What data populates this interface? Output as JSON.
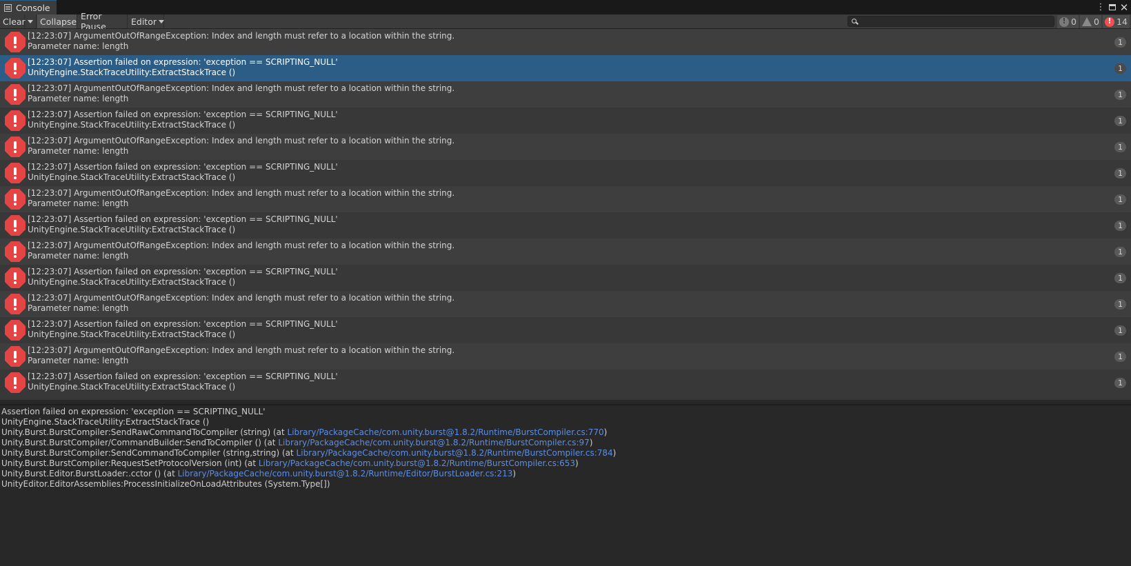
{
  "window": {
    "tab_title": "Console"
  },
  "toolbar": {
    "clear_label": "Clear",
    "collapse_label": "Collapse",
    "error_pause_label": "Error Pause",
    "editor_label": "Editor",
    "search_placeholder": "",
    "info_count": "0",
    "warning_count": "0",
    "error_count": "14"
  },
  "log_entries": [
    {
      "line1": "[12:23:07] ArgumentOutOfRangeException: Index and length must refer to a location within the string.",
      "line2": "Parameter name: length",
      "count": "1",
      "selected": false
    },
    {
      "line1": "[12:23:07] Assertion failed on expression: 'exception == SCRIPTING_NULL'",
      "line2": "UnityEngine.StackTraceUtility:ExtractStackTrace ()",
      "count": "1",
      "selected": true
    },
    {
      "line1": "[12:23:07] ArgumentOutOfRangeException: Index and length must refer to a location within the string.",
      "line2": "Parameter name: length",
      "count": "1",
      "selected": false
    },
    {
      "line1": "[12:23:07] Assertion failed on expression: 'exception == SCRIPTING_NULL'",
      "line2": "UnityEngine.StackTraceUtility:ExtractStackTrace ()",
      "count": "1",
      "selected": false
    },
    {
      "line1": "[12:23:07] ArgumentOutOfRangeException: Index and length must refer to a location within the string.",
      "line2": "Parameter name: length",
      "count": "1",
      "selected": false
    },
    {
      "line1": "[12:23:07] Assertion failed on expression: 'exception == SCRIPTING_NULL'",
      "line2": "UnityEngine.StackTraceUtility:ExtractStackTrace ()",
      "count": "1",
      "selected": false
    },
    {
      "line1": "[12:23:07] ArgumentOutOfRangeException: Index and length must refer to a location within the string.",
      "line2": "Parameter name: length",
      "count": "1",
      "selected": false
    },
    {
      "line1": "[12:23:07] Assertion failed on expression: 'exception == SCRIPTING_NULL'",
      "line2": "UnityEngine.StackTraceUtility:ExtractStackTrace ()",
      "count": "1",
      "selected": false
    },
    {
      "line1": "[12:23:07] ArgumentOutOfRangeException: Index and length must refer to a location within the string.",
      "line2": "Parameter name: length",
      "count": "1",
      "selected": false
    },
    {
      "line1": "[12:23:07] Assertion failed on expression: 'exception == SCRIPTING_NULL'",
      "line2": "UnityEngine.StackTraceUtility:ExtractStackTrace ()",
      "count": "1",
      "selected": false
    },
    {
      "line1": "[12:23:07] ArgumentOutOfRangeException: Index and length must refer to a location within the string.",
      "line2": "Parameter name: length",
      "count": "1",
      "selected": false
    },
    {
      "line1": "[12:23:07] Assertion failed on expression: 'exception == SCRIPTING_NULL'",
      "line2": "UnityEngine.StackTraceUtility:ExtractStackTrace ()",
      "count": "1",
      "selected": false
    },
    {
      "line1": "[12:23:07] ArgumentOutOfRangeException: Index and length must refer to a location within the string.",
      "line2": "Parameter name: length",
      "count": "1",
      "selected": false
    },
    {
      "line1": "[12:23:07] Assertion failed on expression: 'exception == SCRIPTING_NULL'",
      "line2": "UnityEngine.StackTraceUtility:ExtractStackTrace ()",
      "count": "1",
      "selected": false
    }
  ],
  "detail": {
    "lines": [
      {
        "text": "Assertion failed on expression: 'exception == SCRIPTING_NULL'",
        "link": "",
        "suffix": ""
      },
      {
        "text": "UnityEngine.StackTraceUtility:ExtractStackTrace ()",
        "link": "",
        "suffix": ""
      },
      {
        "text": "Unity.Burst.BurstCompiler:SendRawCommandToCompiler (string) (at ",
        "link": "Library/PackageCache/com.unity.burst@1.8.2/Runtime/BurstCompiler.cs:770",
        "suffix": ")"
      },
      {
        "text": "Unity.Burst.BurstCompiler/CommandBuilder:SendToCompiler () (at ",
        "link": "Library/PackageCache/com.unity.burst@1.8.2/Runtime/BurstCompiler.cs:97",
        "suffix": ")"
      },
      {
        "text": "Unity.Burst.BurstCompiler:SendCommandToCompiler (string,string) (at ",
        "link": "Library/PackageCache/com.unity.burst@1.8.2/Runtime/BurstCompiler.cs:784",
        "suffix": ")"
      },
      {
        "text": "Unity.Burst.BurstCompiler:RequestSetProtocolVersion (int) (at ",
        "link": "Library/PackageCache/com.unity.burst@1.8.2/Runtime/BurstCompiler.cs:653",
        "suffix": ")"
      },
      {
        "text": "Unity.Burst.Editor.BurstLoader:.cctor () (at ",
        "link": "Library/PackageCache/com.unity.burst@1.8.2/Runtime/Editor/BurstLoader.cs:213",
        "suffix": ")"
      },
      {
        "text": "UnityEditor.EditorAssemblies:ProcessInitializeOnLoadAttributes (System.Type[])",
        "link": "",
        "suffix": ""
      }
    ]
  },
  "colors": {
    "accent_selected": "#2c5d87",
    "error_red": "#e34444",
    "link_blue": "#5b8ee6"
  }
}
